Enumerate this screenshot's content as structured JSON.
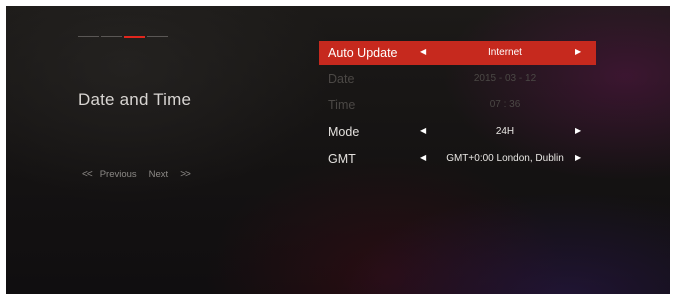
{
  "progress": {
    "total_steps": 4,
    "active_step": 3,
    "accent_color": "#e0261d"
  },
  "page": {
    "title": "Date and Time"
  },
  "nav": {
    "prev_chevron": "<<",
    "previous": "Previous",
    "next": "Next",
    "next_chevron": ">>"
  },
  "settings": [
    {
      "label": "Auto Update",
      "value": "Internet",
      "state": "selected",
      "arrows": true
    },
    {
      "label": "Date",
      "value": "2015 - 03 - 12",
      "state": "disabled",
      "arrows": false
    },
    {
      "label": "Time",
      "value": "07 : 36",
      "state": "disabled",
      "arrows": false
    },
    {
      "label": "Mode",
      "value": "24H",
      "state": "normal",
      "arrows": true
    },
    {
      "label": "GMT",
      "value": "GMT+0:00 London, Dublin",
      "state": "normal",
      "arrows": true
    }
  ],
  "icons": {
    "left_arrow": "triangle-left-icon",
    "right_arrow": "triangle-right-icon"
  },
  "colors": {
    "selected_row": "#c6291e",
    "disabled_text": "#4b4845",
    "text": "#e3e0dd"
  }
}
